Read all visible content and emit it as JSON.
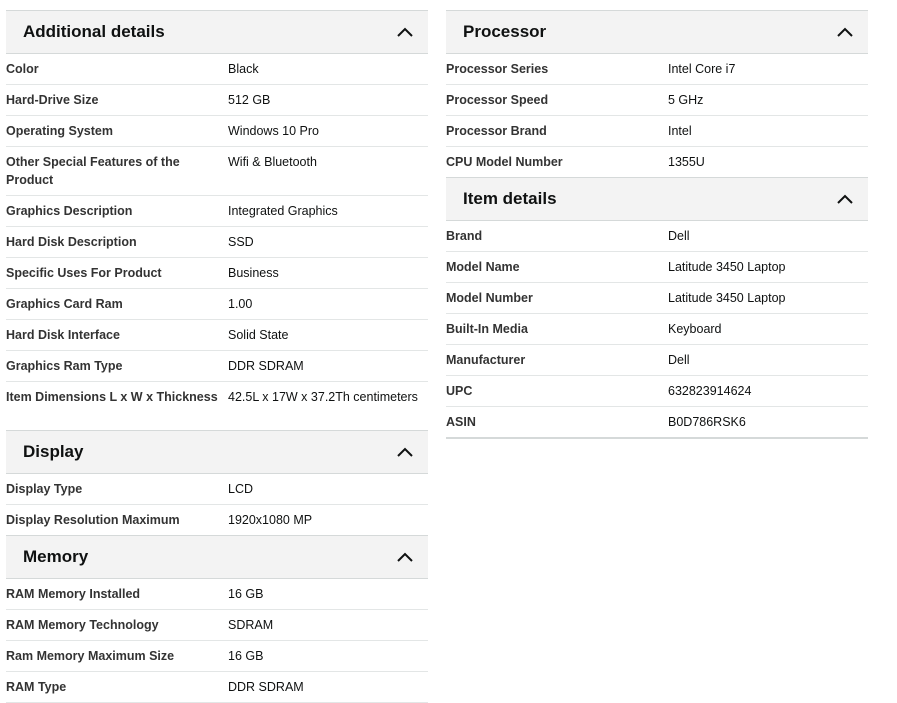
{
  "additional": {
    "title": "Additional details",
    "rows": [
      {
        "key": "Color",
        "value": "Black"
      },
      {
        "key": "Hard-Drive Size",
        "value": "512 GB"
      },
      {
        "key": "Operating System",
        "value": "Windows 10 Pro"
      },
      {
        "key": "Other Special Features of the Product",
        "value": "Wifi & Bluetooth"
      },
      {
        "key": "Graphics Description",
        "value": "Integrated Graphics"
      },
      {
        "key": "Hard Disk Description",
        "value": "SSD"
      },
      {
        "key": "Specific Uses For Product",
        "value": "Business"
      },
      {
        "key": "Graphics Card Ram",
        "value": "1.00"
      },
      {
        "key": "Hard Disk Interface",
        "value": "Solid State"
      },
      {
        "key": "Graphics Ram Type",
        "value": "DDR SDRAM"
      },
      {
        "key": "Item Dimensions L x W x Thickness",
        "value": "42.5L x 17W x 37.2Th centimeters"
      }
    ]
  },
  "display": {
    "title": "Display",
    "rows": [
      {
        "key": "Display Type",
        "value": "LCD"
      },
      {
        "key": "Display Resolution Maximum",
        "value": "1920x1080 MP"
      }
    ]
  },
  "memory": {
    "title": "Memory",
    "rows": [
      {
        "key": "RAM Memory Installed",
        "value": "16 GB"
      },
      {
        "key": "RAM Memory Technology",
        "value": "SDRAM"
      },
      {
        "key": "Ram Memory Maximum Size",
        "value": "16 GB"
      },
      {
        "key": "RAM Type",
        "value": "DDR SDRAM"
      }
    ]
  },
  "processor": {
    "title": "Processor",
    "rows": [
      {
        "key": "Processor Series",
        "value": "Intel Core i7"
      },
      {
        "key": "Processor Speed",
        "value": "5 GHz"
      },
      {
        "key": "Processor Brand",
        "value": "Intel"
      },
      {
        "key": "CPU Model Number",
        "value": "1355U"
      }
    ]
  },
  "item": {
    "title": "Item details",
    "rows": [
      {
        "key": "Brand",
        "value": "Dell"
      },
      {
        "key": "Model Name",
        "value": "Latitude 3450 Laptop"
      },
      {
        "key": "Model Number",
        "value": "Latitude 3450 Laptop"
      },
      {
        "key": "Built-In Media",
        "value": "Keyboard"
      },
      {
        "key": "Manufacturer",
        "value": "Dell"
      },
      {
        "key": "UPC",
        "value": "632823914624"
      },
      {
        "key": "ASIN",
        "value": "B0D786RSK6"
      }
    ]
  },
  "icons": {
    "collapse": "chevron-up-icon"
  },
  "colors": {
    "header_bg": "#f3f3f3",
    "divider": "#e3e6e6",
    "text": "#0f1111"
  }
}
